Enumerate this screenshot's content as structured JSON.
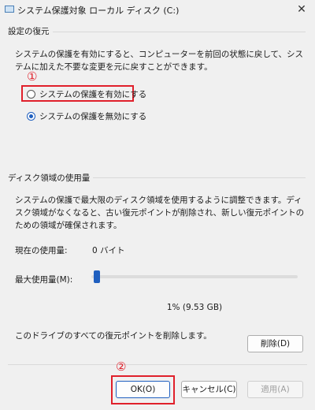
{
  "window": {
    "title": "システム保護対象 ローカル ディスク (C:)",
    "close_glyph": "✕"
  },
  "restore_settings": {
    "group_title": "設定の復元",
    "description": "システムの保護を有効にすると、コンピューターを前回の状態に戻して、システムに加えた不要な変更を元に戻すことができます。",
    "options": [
      {
        "label": "システムの保護を有効にする",
        "selected": false
      },
      {
        "label": "システムの保護を無効にする",
        "selected": true
      }
    ]
  },
  "disk_usage": {
    "group_title": "ディスク領域の使用量",
    "description": "システムの保護で最大限のディスク領域を使用するように調整できます。ディスク領域がなくなると、古い復元ポイントが削除され、新しい復元ポイントのための領域が確保されます。",
    "current_label": "現在の使用量:",
    "current_value": "0 バイト",
    "max_label": "最大使用量(M):",
    "max_usage_fraction": 0.01,
    "max_readout": "1% (9.53 GB)",
    "delete_text": "このドライブのすべての復元ポイントを削除します。",
    "delete_button": "削除(D)"
  },
  "buttons": {
    "ok": "OK(O)",
    "cancel": "キャンセル(C)",
    "apply": "適用(A)"
  },
  "annotations": {
    "marker1": "①",
    "marker2": "②",
    "highlight_color": "#e0202b"
  },
  "colors": {
    "accent": "#1f5fbf"
  }
}
